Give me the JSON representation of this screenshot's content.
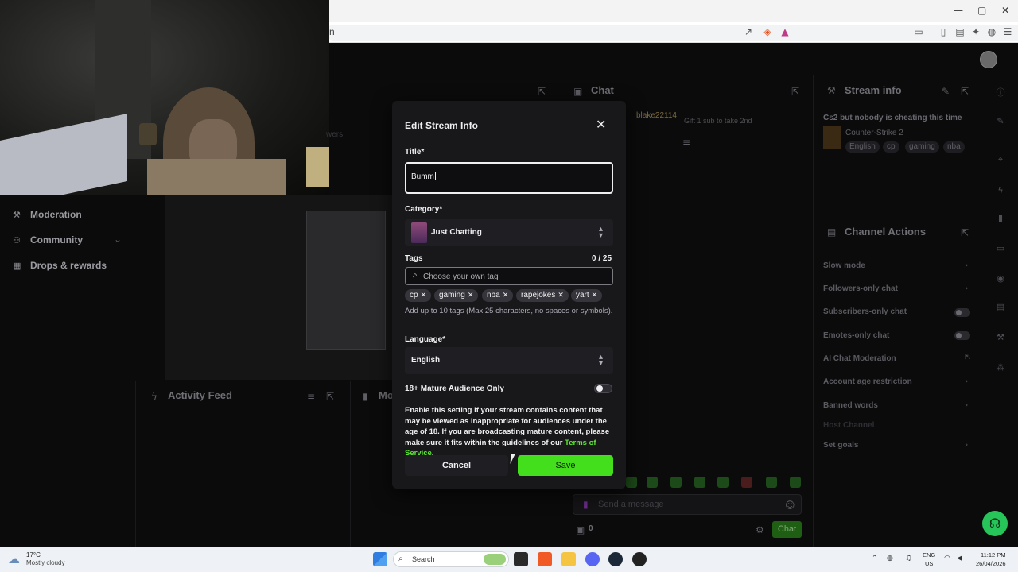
{
  "browser": {
    "url_fragment": "n",
    "window_controls": {
      "minimize": "—",
      "maximize": "▢",
      "close": "✕"
    }
  },
  "nav": {
    "moderation": "Moderation",
    "community": "Community",
    "drops": "Drops & rewards"
  },
  "panels": {
    "chat": "Chat",
    "activity_feed": "Activity Feed",
    "mod_partial": "Mo",
    "stream_info": "Stream info",
    "channel_actions": "Channel Actions",
    "viewers_partial": "wers"
  },
  "chat": {
    "username": "blake22114",
    "gift_text": "Gift 1 sub to take 2nd",
    "placeholder": "Send a message",
    "points": "0",
    "chat_button": "Chat"
  },
  "stream_info": {
    "title": "Cs2 but nobody is cheating this time",
    "game": "Counter-Strike 2",
    "tags": [
      "English",
      "cp",
      "gaming",
      "nba"
    ]
  },
  "channel_actions": [
    {
      "label": "Slow mode",
      "control": "chevron"
    },
    {
      "label": "Followers-only chat",
      "control": "chevron"
    },
    {
      "label": "Subscribers-only chat",
      "control": "toggle"
    },
    {
      "label": "Emotes-only chat",
      "control": "toggle"
    },
    {
      "label": "AI Chat Moderation",
      "control": "external"
    },
    {
      "label": "Account age restriction",
      "control": "chevron"
    },
    {
      "label": "Banned words",
      "control": "chevron"
    },
    {
      "label": "Host Channel",
      "control": "none"
    },
    {
      "label": "Set goals",
      "control": "chevron"
    }
  ],
  "modal": {
    "heading": "Edit Stream Info",
    "close": "✕",
    "title_label": "Title*",
    "title_value": "Bumm",
    "category_label": "Category*",
    "category_value": "Just Chatting",
    "tags_label": "Tags",
    "tags_count": "0 / 25",
    "tag_placeholder": "Choose your own tag",
    "tags": [
      "cp",
      "gaming",
      "nba",
      "rapejokes",
      "yart"
    ],
    "tag_help": "Add up to 10 tags (Max 25 characters, no spaces or symbols).",
    "language_label": "Language*",
    "language_value": "English",
    "mature_label": "18+ Mature Audience Only",
    "mature_enabled": false,
    "mature_desc": "Enable this setting if your stream contains content that may be viewed as inappropriate for audiences under the age of 18. If you are broadcasting mature content, please make sure it fits within the guidelines of our ",
    "terms_link": "Terms of Service",
    "terms_end": ".",
    "cancel": "Cancel",
    "save": "Save",
    "accent": "#43df1c"
  },
  "taskbar": {
    "temperature": "17°C",
    "condition": "Mostly cloudy",
    "search": "Search",
    "lang_line1": "ENG",
    "lang_line2": "US",
    "time": "11:12 PM",
    "date": "26/04/2026"
  }
}
